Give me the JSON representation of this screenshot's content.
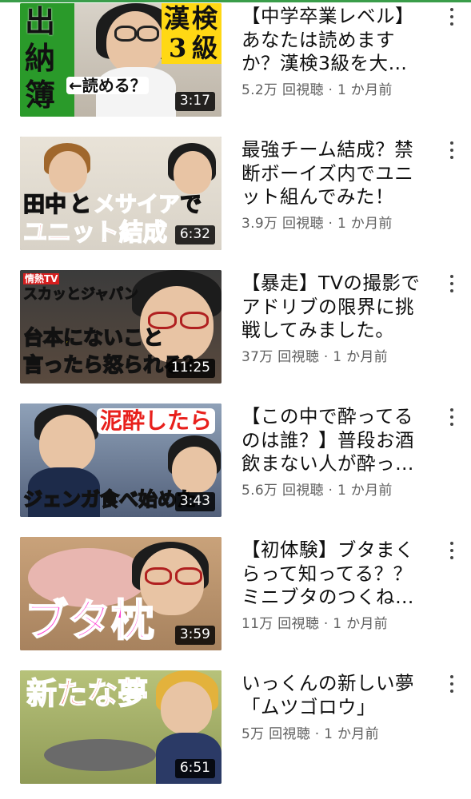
{
  "videos": [
    {
      "title": "【中学卒業レベル】あなたは読めますか？漢検3級を大…",
      "views": "5.2万 回視聴",
      "age": "1 か月前",
      "duration": "3:17",
      "thumb_text": [
        "出",
        "納",
        "簿",
        "←読める？",
        "漢",
        "検",
        "3",
        "級"
      ]
    },
    {
      "title": "最強チーム結成？禁断ボーイズ内でユニット組んでみた！",
      "views": "3.9万 回視聴",
      "age": "1 か月前",
      "duration": "6:32",
      "thumb_text": [
        "田中",
        "と",
        "メサイア",
        "で",
        "ユニット結成"
      ]
    },
    {
      "title": "【暴走】TVの撮影でアドリブの限界に挑戦してみました。",
      "views": "37万 回視聴",
      "age": "1 か月前",
      "duration": "11:25",
      "thumb_text": [
        "情熱TV",
        "スカッとジャパン",
        "台本にないこと",
        "言ったら",
        "怒られる？"
      ]
    },
    {
      "title": "【この中で酔ってるのは誰？】普段お酒飲まない人が酔っ…",
      "views": "5.6万 回視聴",
      "age": "1 か月前",
      "duration": "3:43",
      "thumb_text": [
        "泥酔したら",
        "ジェンガ食べ始めた"
      ]
    },
    {
      "title": "【初体験】ブタまくらって知ってる？？ミニブタのつくね…",
      "views": "11万 回視聴",
      "age": "1 か月前",
      "duration": "3:59",
      "thumb_text": [
        "ブタ枕"
      ]
    },
    {
      "title": "いっくんの新しい夢「ムツゴロウ」",
      "views": "5万 回視聴",
      "age": "1 か月前",
      "duration": "6:51",
      "thumb_text": [
        "新たな夢"
      ]
    }
  ],
  "meta_separator": " · ",
  "menu_icon": "more-vert-icon",
  "colors": {
    "title": "#0f0f0f",
    "meta": "#606060",
    "accent_top": "#3a9d4a"
  }
}
